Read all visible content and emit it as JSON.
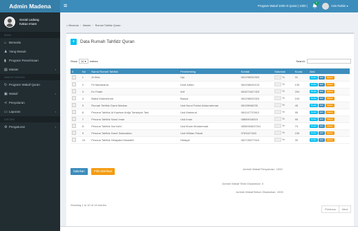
{
  "app": {
    "brand": "Admin Madena"
  },
  "user_panel": {
    "line1": "Sosial Ladang",
    "line2": "Kakao Imam"
  },
  "sidebar": {
    "header_main": "MAIN",
    "items": [
      {
        "label": "Beranda",
        "icon": "home-icon"
      },
      {
        "label": "Yang Masuk",
        "icon": "user-icon"
      },
      {
        "label": "Program Penerimaan",
        "icon": "bar-chart-icon"
      },
      {
        "label": "Master",
        "icon": "file-icon",
        "has_children": true
      }
    ],
    "header_wakaf": "WAKAF QURAN",
    "items2": [
      {
        "label": "Program Wakaf Quran",
        "icon": "refresh-icon"
      },
      {
        "label": "Wakaf",
        "icon": "gift-icon",
        "has_children": true
      },
      {
        "label": "Penyaluran",
        "icon": "share-icon"
      },
      {
        "label": "Laporan",
        "icon": "laptop-icon",
        "has_children": true
      }
    ],
    "header_sistem": "SISTEM",
    "items3": [
      {
        "label": "Pengaturan",
        "icon": "cogs-icon",
        "has_children": true
      }
    ]
  },
  "topbar": {
    "info": "Program Wakaf 1000 Al Quran | 1000 |",
    "badge": "0",
    "user": "Anis Rahim"
  },
  "breadcrumb": [
    "Beranda",
    "Master",
    "Rumah Tahfidz Quran"
  ],
  "box": {
    "title": "Data Rumah Tahfidz Quran"
  },
  "datatable": {
    "show_label": "Show",
    "show_value": "10",
    "entries_label": "entries",
    "search_label": "Search:",
    "columns": [
      "#",
      "No",
      "Nama Rumah Tahfidz",
      "Pembimbing",
      "Kontak",
      "Salurkan",
      "Kuota",
      "Aksi"
    ],
    "rows": [
      {
        "no": "1",
        "nama": "Al Ikha",
        "pembimbing": "Ujo",
        "kontak": "081298030303",
        "pct": "%",
        "kuota": "31"
      },
      {
        "no": "2",
        "nama": "Pii Madarama",
        "pembimbing": "Dedi Arfian",
        "kontak": "081298030123",
        "pct": "%",
        "kuota": "133"
      },
      {
        "no": "3",
        "nama": "Ec Fatah",
        "pembimbing": "Arif",
        "kontak": "081871847423",
        "pct": "%",
        "kuota": "204"
      },
      {
        "no": "4",
        "nama": "Baitul Mutma'inah",
        "pembimbing": "Banya",
        "kontak": "081298032323",
        "pct": "%",
        "kuota": "103"
      },
      {
        "no": "5",
        "nama": "Rumah Tahfidz Darut Markaz",
        "pembimbing": "Usd Nurul Fahmi Abdurrahman",
        "kontak": "08128948230",
        "pct": "%",
        "kuota": "45"
      },
      {
        "no": "6",
        "nama": "Pesona Tahfidz Al Kautsar Ardja Tanwiyah Tani",
        "pembimbing": "Usd Mahmud",
        "kontak": "081247723912",
        "pct": "%",
        "kuota": "95"
      },
      {
        "no": "7",
        "nama": "Pesona Tahfidz Nurul Iman",
        "pembimbing": "Usd Iman",
        "kontak": "08889018519",
        "pct": "%",
        "kuota": "95"
      },
      {
        "no": "8",
        "nama": "Pesona Tahfidz Nur Ilahi",
        "pembimbing": "Usd Ilham Muhammad",
        "kontak": "0836934837341",
        "pct": "%",
        "kuota": "73"
      },
      {
        "no": "9",
        "nama": "Pesona Tahfidz Darut Salamatan",
        "pembimbing": "Usd Wildan Faizal",
        "kontak": "0763427483",
        "pct": "%",
        "kuota": "155"
      },
      {
        "no": "10",
        "nama": "Pesona Tahfidz Hidayatul Mustafid",
        "pembimbing": "Hidayat",
        "kontak": "081728377010",
        "pct": "%",
        "kuota": "30"
      }
    ],
    "aksi_labels": {
      "detail": "Detail",
      "edit": "Edit",
      "hapus": "Hapus"
    }
  },
  "actions": {
    "salurkan": "Salurkan",
    "pilih_distribusi": "Pilih Distribusi"
  },
  "summary": {
    "jumlah_label": "Jumlah Wakaf Penyaluran",
    "jumlah_value": "1000",
    "wakaf_label": "Jumlah Wakaf Telah Disalurkan",
    "wakaf_value": "0",
    "sisa_label": "Jumlah Wakaf Belum Disalurkan",
    "sisa_value": "1000"
  },
  "footer": {
    "info": "Showing 1 to 10 of 15 entries",
    "previous": "Previous",
    "next": "Next"
  }
}
